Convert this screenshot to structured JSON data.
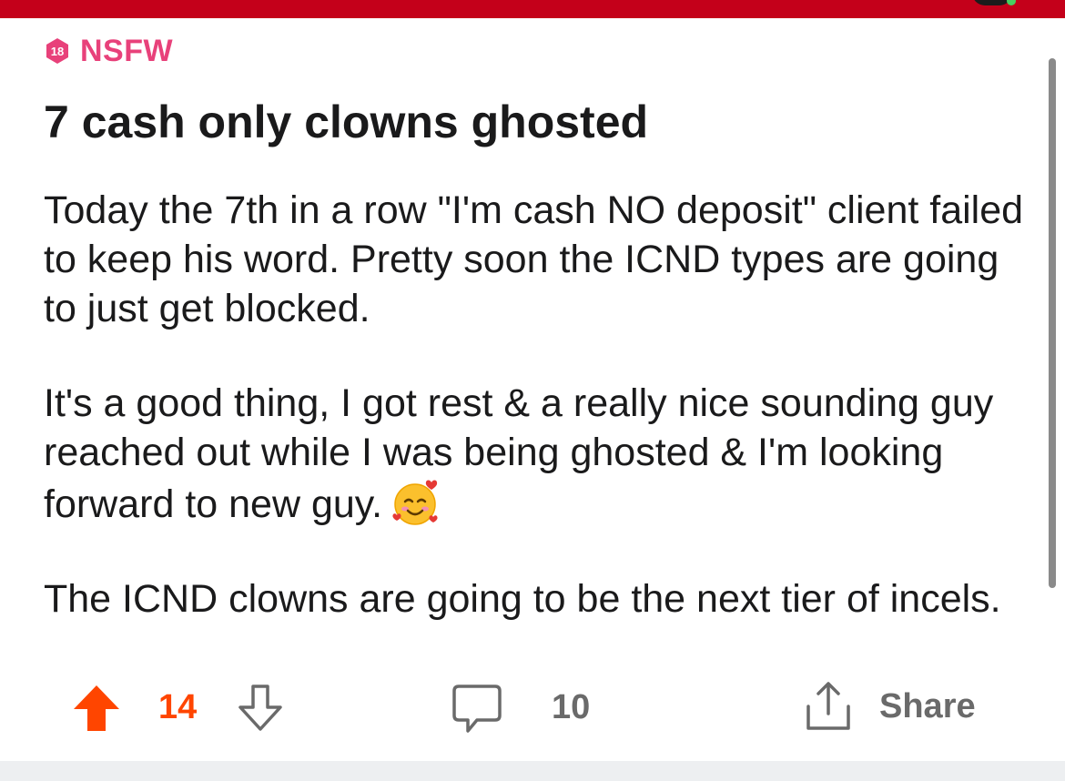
{
  "post": {
    "nsfw_label": "NSFW",
    "nsfw_badge_text": "18",
    "title": "7 cash only clowns ghosted",
    "paragraphs": [
      "Today the 7th in a row \"I'm cash NO deposit\" client failed to keep his word. Pretty soon the ICND types are going to just get blocked.",
      "It's a good thing, I got rest & a really nice sounding guy reached out while I was being ghosted & I'm looking forward to new guy.",
      "The ICND clowns are going to be the next tier of incels."
    ],
    "emoji_icon": "smiling-face-with-hearts-icon"
  },
  "actions": {
    "score": "14",
    "comment_count": "10",
    "share_label": "Share"
  },
  "colors": {
    "top_bar": "#c4001a",
    "nsfw": "#e8417a",
    "upvote_active": "#ff4500",
    "muted": "#6a6a6a"
  },
  "icons": {
    "upvote": "upvote-arrow-icon",
    "downvote": "downvote-arrow-icon",
    "comment": "comment-bubble-icon",
    "share": "share-icon"
  }
}
